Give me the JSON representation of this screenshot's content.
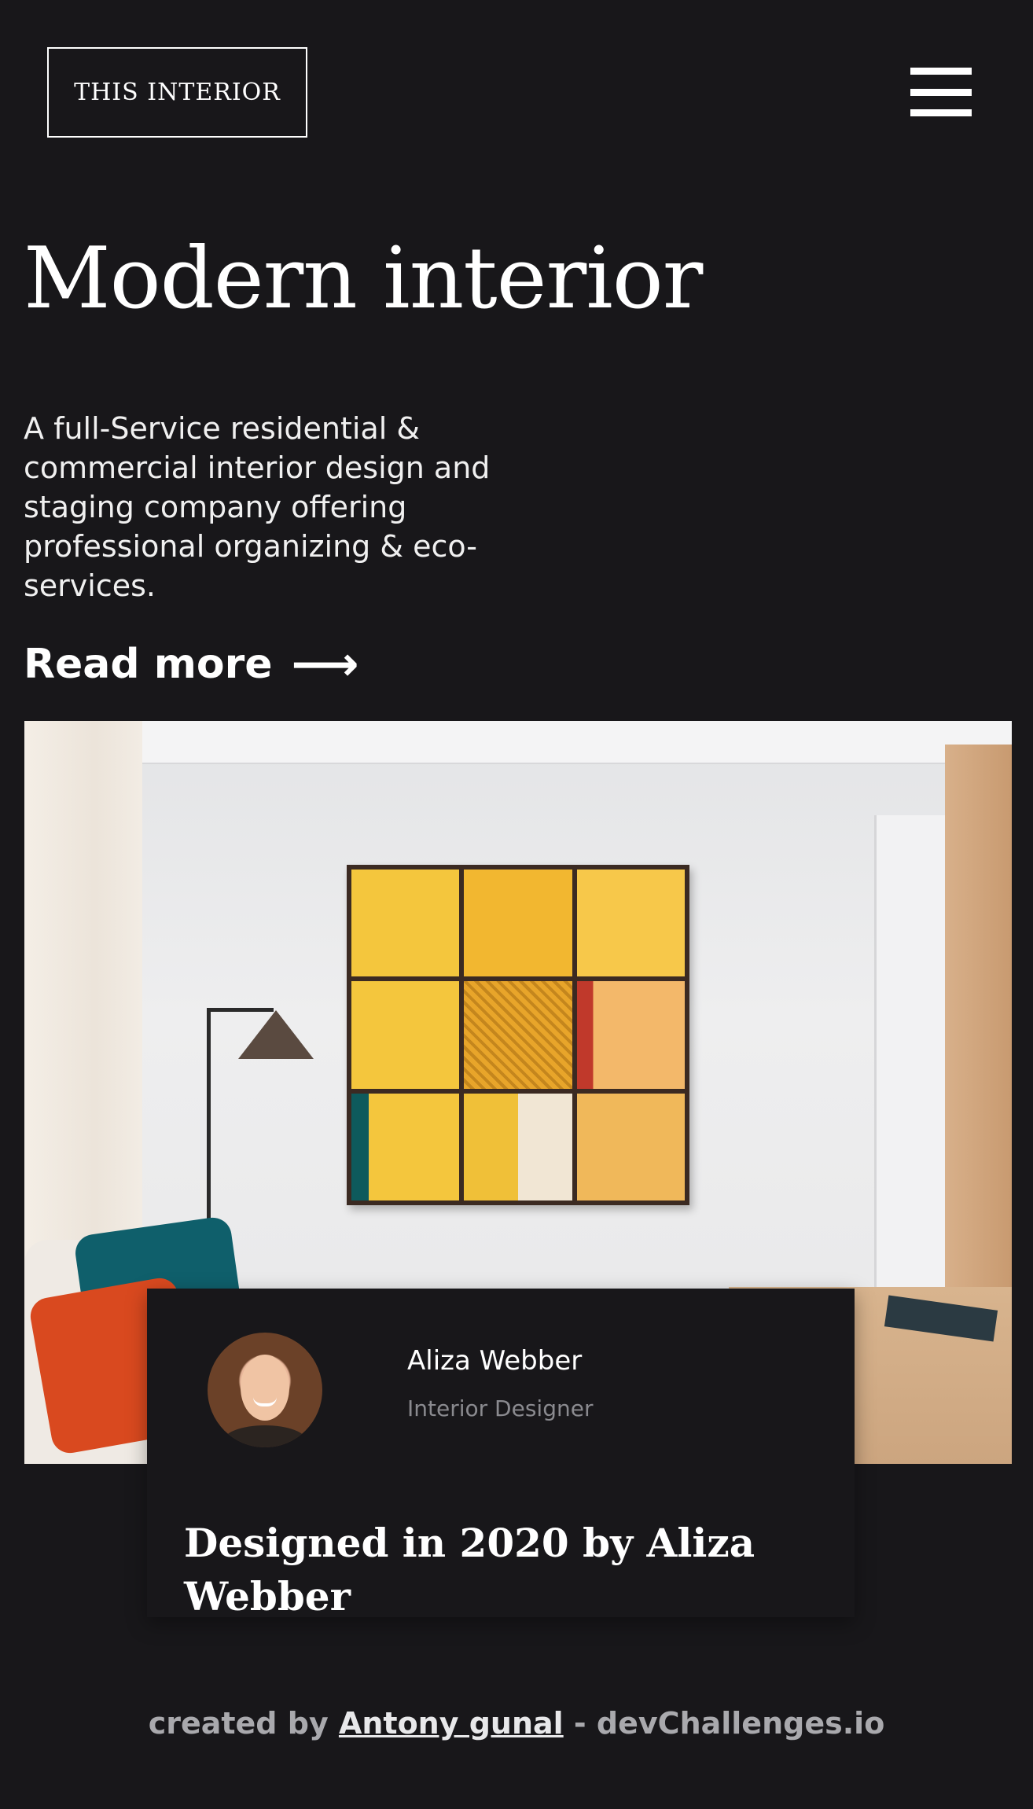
{
  "header": {
    "logo_text": "THIS INTERIOR",
    "menu_icon": "hamburger-menu-icon"
  },
  "hero": {
    "title": "Modern interior",
    "description": "A full-Service residential & commercial interior design and staging company offering professional organizing & eco-services.",
    "read_more_label": "Read more",
    "read_more_arrow": "⟶"
  },
  "feature": {
    "image_alt": "Living room with framed yellow door collage art",
    "designer_name": "Aliza Webber",
    "designer_role": "Interior Designer",
    "caption": "Designed in 2020 by Aliza Webber"
  },
  "footer": {
    "prefix": "created by ",
    "author": "Antony gunal",
    "suffix": " - devChallenges.io"
  }
}
